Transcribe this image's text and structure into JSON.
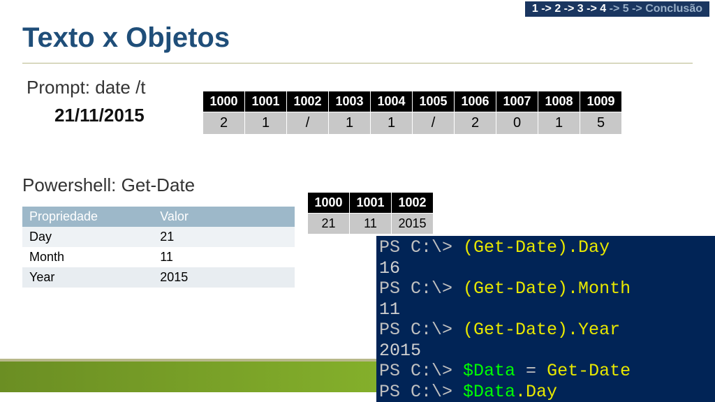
{
  "breadcrumb": {
    "s1": "1",
    "s2": " -> 2",
    "s3": " -> 3",
    "s4": " -> 4",
    "s5": " -> 5",
    "s6": " -> Conclusão"
  },
  "title": "Texto x Objetos",
  "prompt": {
    "label": "Prompt:  date /t",
    "result": "21/11/2015"
  },
  "mem1": {
    "headers": [
      "1000",
      "1001",
      "1002",
      "1003",
      "1004",
      "1005",
      "1006",
      "1007",
      "1008",
      "1009"
    ],
    "cells": [
      "2",
      "1",
      "/",
      "1",
      "1",
      "/",
      "2",
      "0",
      "1",
      "5"
    ]
  },
  "ps_label": "Powershell:  Get-Date",
  "prop_table": {
    "h1": "Propriedade",
    "h2": "Valor",
    "rows": [
      {
        "k": "Day",
        "v": "21"
      },
      {
        "k": "Month",
        "v": "11"
      },
      {
        "k": "Year",
        "v": "2015"
      }
    ]
  },
  "mem2": {
    "headers": [
      "1000",
      "1001",
      "1002"
    ],
    "cells": [
      "21",
      "11",
      "2015"
    ]
  },
  "console": {
    "l1_ps": "PS C:\\> ",
    "l1_cmd": "(Get-Date).Day",
    "l2": "16",
    "l3_ps": "PS C:\\> ",
    "l3_cmd": "(Get-Date).Month",
    "l4": "11",
    "l5_ps": "PS C:\\> ",
    "l5_cmd": "(Get-Date).Year",
    "l6": "2015",
    "l7_ps": "PS C:\\> ",
    "l7_var": "$Data",
    "l7_rest": " = ",
    "l7_cmd": "Get-Date",
    "l8_ps": "PS C:\\> ",
    "l8_var": "$Data",
    "l8_cmd": ".Day"
  }
}
